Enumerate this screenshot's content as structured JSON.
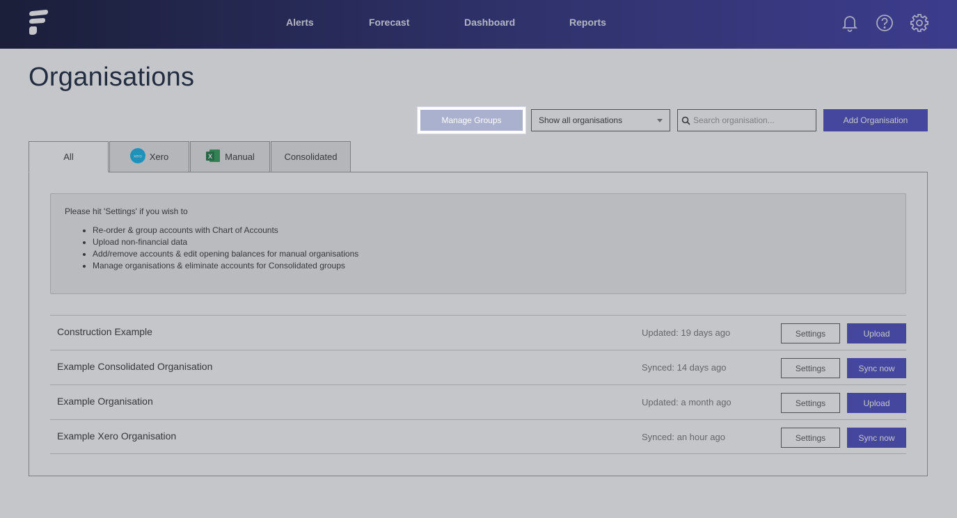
{
  "nav": {
    "items": [
      "Alerts",
      "Forecast",
      "Dashboard",
      "Reports"
    ],
    "icons": [
      "bell-icon",
      "help-icon",
      "gear-icon"
    ]
  },
  "page": {
    "title": "Organisations"
  },
  "toolbar": {
    "manage_groups": "Manage Groups",
    "filter_selected": "Show all organisations",
    "search_placeholder": "Search organisation...",
    "add_organisation": "Add Organisation"
  },
  "tabs": [
    {
      "label": "All",
      "icon": null
    },
    {
      "label": "Xero",
      "icon": "xero-icon"
    },
    {
      "label": "Manual",
      "icon": "excel-icon"
    },
    {
      "label": "Consolidated",
      "icon": null
    }
  ],
  "info": {
    "intro": "Please hit 'Settings' if you wish to",
    "items": [
      "Re-order & group accounts with Chart of Accounts",
      "Upload non-financial data",
      "Add/remove accounts & edit opening balances for manual organisations",
      "Manage organisations & eliminate accounts for Consolidated groups"
    ]
  },
  "organisations": [
    {
      "name": "Construction Example",
      "status": "Updated: 19 days ago",
      "settings": "Settings",
      "action": "Upload"
    },
    {
      "name": "Example Consolidated Organisation",
      "status": "Synced: 14 days ago",
      "settings": "Settings",
      "action": "Sync now"
    },
    {
      "name": "Example Organisation",
      "status": "Updated: a month ago",
      "settings": "Settings",
      "action": "Upload"
    },
    {
      "name": "Example Xero Organisation",
      "status": "Synced: an hour ago",
      "settings": "Settings",
      "action": "Sync now"
    }
  ],
  "colors": {
    "nav_start": "#0d1030",
    "nav_end": "#3d3aa8",
    "primary_button": "#4a4ac0",
    "highlight_button": "#aab1cf"
  }
}
